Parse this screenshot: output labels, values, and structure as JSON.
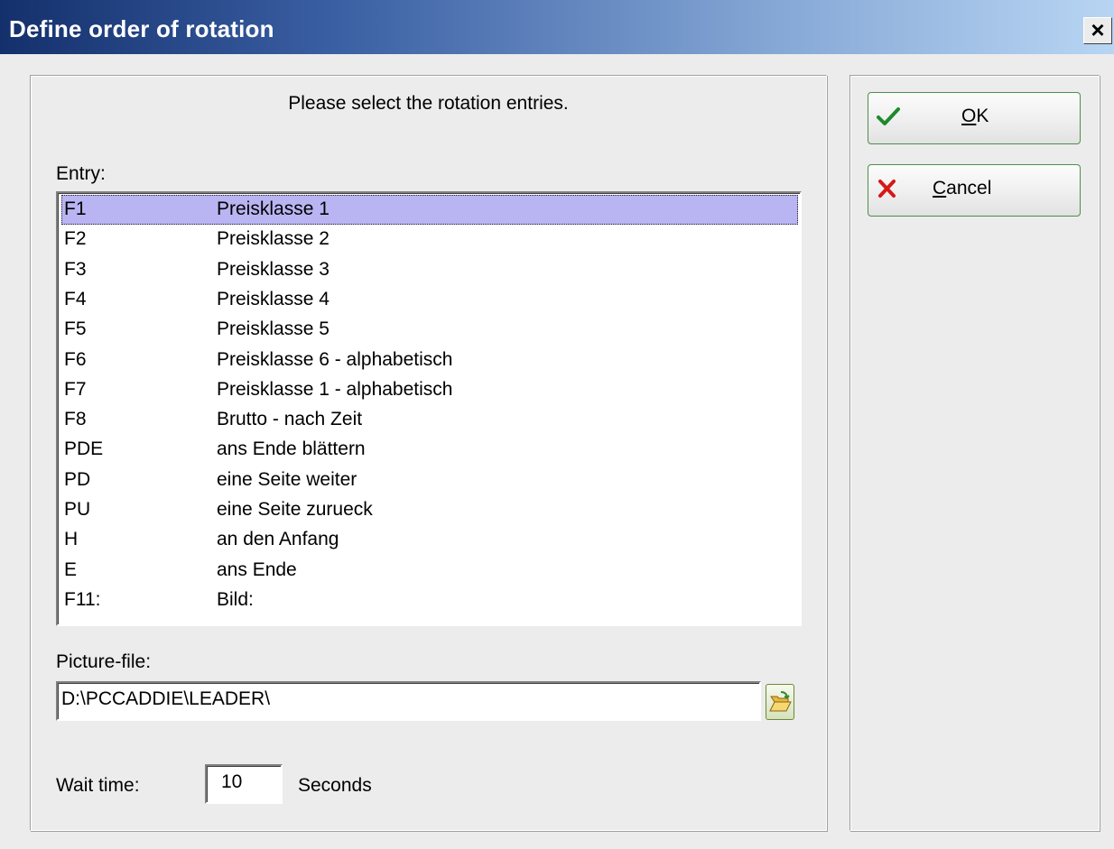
{
  "window": {
    "title": "Define order of rotation",
    "close_label": "×"
  },
  "instruction": "Please select the rotation entries.",
  "entry_label": "Entry:",
  "entries": [
    {
      "key": "F1",
      "value": "Preisklasse 1"
    },
    {
      "key": "F2",
      "value": "Preisklasse 2"
    },
    {
      "key": "F3",
      "value": "Preisklasse 3"
    },
    {
      "key": "F4",
      "value": "Preisklasse 4"
    },
    {
      "key": "F5",
      "value": "Preisklasse 5"
    },
    {
      "key": "F6",
      "value": "Preisklasse 6 - alphabetisch"
    },
    {
      "key": "F7",
      "value": "Preisklasse 1 - alphabetisch"
    },
    {
      "key": "F8",
      "value": "Brutto - nach Zeit"
    },
    {
      "key": "PDE",
      "value": "ans Ende blättern"
    },
    {
      "key": "PD",
      "value": "eine Seite weiter"
    },
    {
      "key": "PU",
      "value": "eine Seite zurueck"
    },
    {
      "key": "H",
      "value": "an den Anfang"
    },
    {
      "key": "E",
      "value": "ans Ende"
    },
    {
      "key": "F11:",
      "value": "Bild:"
    }
  ],
  "selected_index": 0,
  "picture_file": {
    "label": "Picture-file:",
    "value": "D:\\PCCADDIE\\LEADER\\"
  },
  "wait_time": {
    "label": "Wait time:",
    "value": "10",
    "unit": "Seconds"
  },
  "buttons": {
    "ok": {
      "accel": "O",
      "rest": "K",
      "icon": "checkmark-icon"
    },
    "cancel": {
      "accel": "C",
      "rest": "ancel",
      "icon": "red-x-icon"
    }
  },
  "colors": {
    "selection": "#b9b4f2",
    "title_start": "#14306c",
    "title_end": "#b8d5f3"
  }
}
